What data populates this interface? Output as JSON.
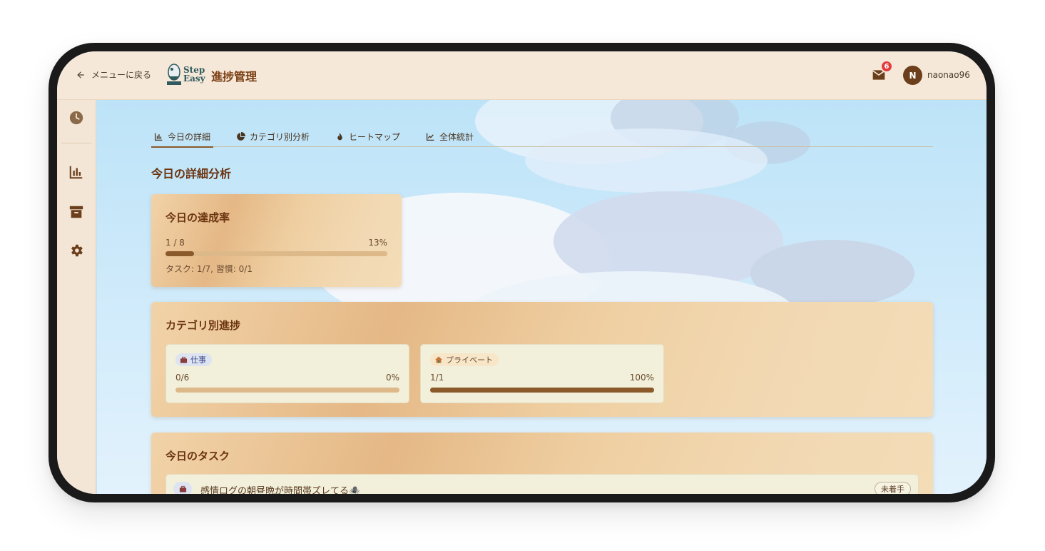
{
  "header": {
    "back_label": "メニューに戻る",
    "logo_line1": "Step",
    "logo_line2": "Easy",
    "page_title": "進捗管理",
    "mail_count": "6",
    "avatar_initial": "N",
    "username": "naonao96"
  },
  "sidebar": {
    "items": [
      {
        "icon": "clock-icon"
      },
      {
        "icon": "bar-chart-icon"
      },
      {
        "icon": "archive-icon"
      },
      {
        "icon": "gear-icon"
      }
    ]
  },
  "tabs": [
    {
      "label": "今日の詳細",
      "icon": "bar-chart-icon",
      "active": true
    },
    {
      "label": "カテゴリ別分析",
      "icon": "pie-chart-icon",
      "active": false
    },
    {
      "label": "ヒートマップ",
      "icon": "flame-icon",
      "active": false
    },
    {
      "label": "全体統計",
      "icon": "line-chart-icon",
      "active": false
    }
  ],
  "section_title": "今日の詳細分析",
  "rate_card": {
    "title": "今日の達成率",
    "count": "1 / 8",
    "percent": "13%",
    "progress": 0.13,
    "sub": "タスク: 1/7, 習慣: 0/1"
  },
  "category_card": {
    "title": "カテゴリ別進捗",
    "categories": [
      {
        "name": "仕事",
        "count": "0/6",
        "percent": "0%",
        "progress": 0.0,
        "icon": "briefcase-icon"
      },
      {
        "name": "プライベート",
        "count": "1/1",
        "percent": "100%",
        "progress": 1.0,
        "icon": "house-icon"
      }
    ]
  },
  "task_card": {
    "title": "今日のタスク",
    "tasks": [
      {
        "text": "感情ログの朝昼晩が時間帯ズレてる🕷️",
        "status": "未着手",
        "icon": "briefcase-icon"
      }
    ]
  },
  "colors": {
    "accent_brown": "#8a5a2a",
    "title_brown": "#6b3410",
    "badge_red": "#e23c3c",
    "sky": "#bde3f8"
  }
}
